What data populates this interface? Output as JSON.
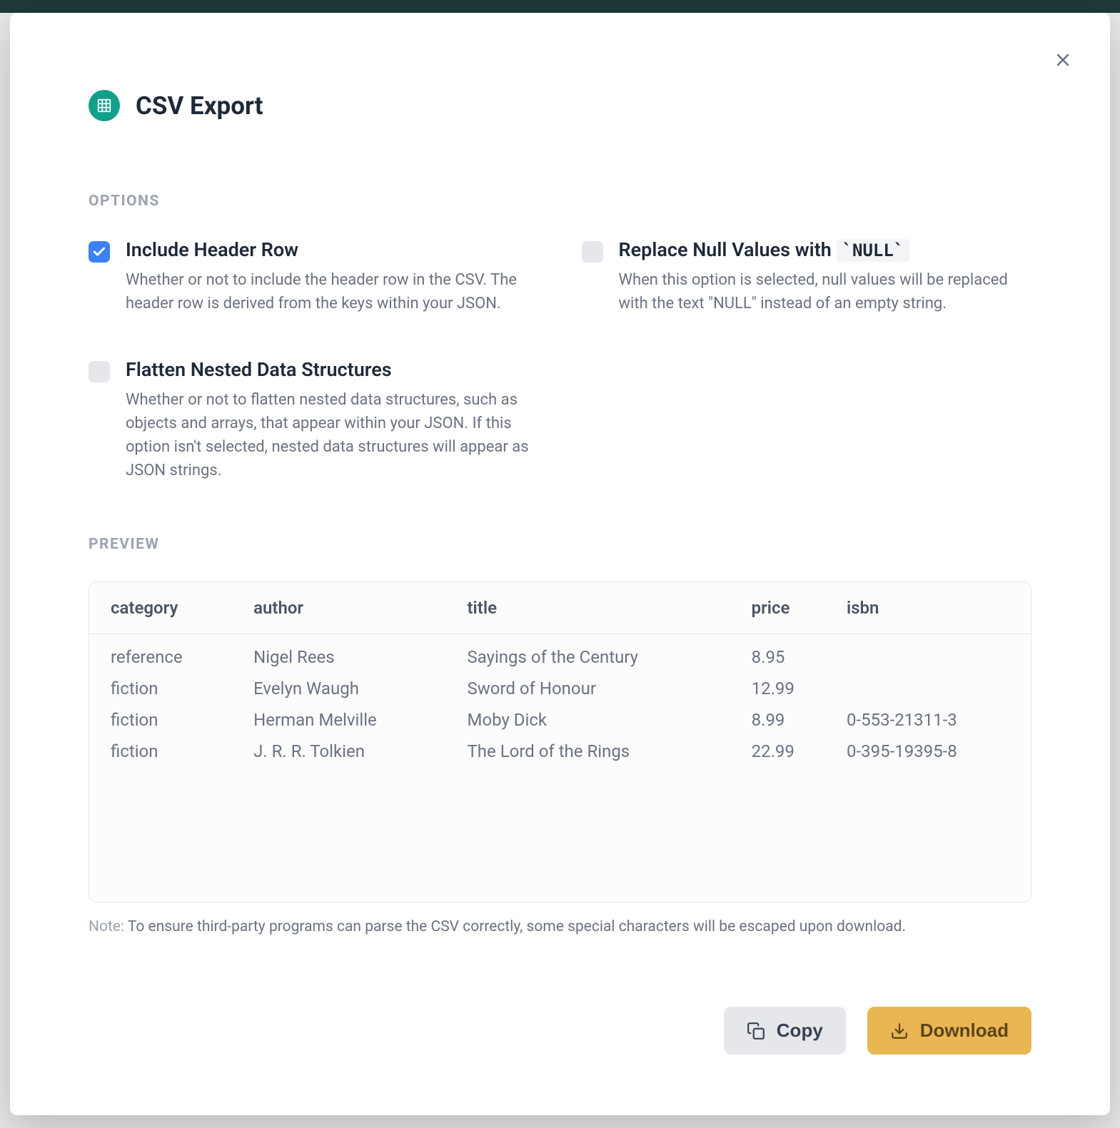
{
  "modal": {
    "title": "CSV Export",
    "sections": {
      "options": "OPTIONS",
      "preview": "PREVIEW"
    },
    "options": {
      "include_header": {
        "label": "Include Header Row",
        "desc": "Whether or not to include the header row in the CSV. The header row is derived from the keys within your JSON.",
        "checked": true
      },
      "replace_null": {
        "label_prefix": "Replace Null Values with ",
        "label_code": "`NULL`",
        "desc": "When this option is selected, null values will be replaced with the text \"NULL\" instead of an empty string.",
        "checked": false
      },
      "flatten": {
        "label": "Flatten Nested Data Structures",
        "desc": "Whether or not to flatten nested data structures, such as objects and arrays, that appear within your JSON. If this option isn't selected, nested data structures will appear as JSON strings.",
        "checked": false
      }
    },
    "preview": {
      "headers": [
        "category",
        "author",
        "title",
        "price",
        "isbn"
      ],
      "rows": [
        {
          "category": "reference",
          "author": "Nigel Rees",
          "title": "Sayings of the Century",
          "price": "8.95",
          "isbn": ""
        },
        {
          "category": "fiction",
          "author": "Evelyn Waugh",
          "title": "Sword of Honour",
          "price": "12.99",
          "isbn": ""
        },
        {
          "category": "fiction",
          "author": "Herman Melville",
          "title": "Moby Dick",
          "price": "8.99",
          "isbn": "0-553-21311-3"
        },
        {
          "category": "fiction",
          "author": "J. R. R. Tolkien",
          "title": "The Lord of the Rings",
          "price": "22.99",
          "isbn": "0-395-19395-8"
        }
      ]
    },
    "note": {
      "prefix": "Note:",
      "text": " To ensure third-party programs can parse the CSV correctly, some special characters will be escaped upon download."
    },
    "buttons": {
      "copy": "Copy",
      "download": "Download"
    }
  },
  "colors": {
    "brand": "#13a08a",
    "primary_button": "#e9b653",
    "checkbox_checked": "#3b82f6"
  }
}
